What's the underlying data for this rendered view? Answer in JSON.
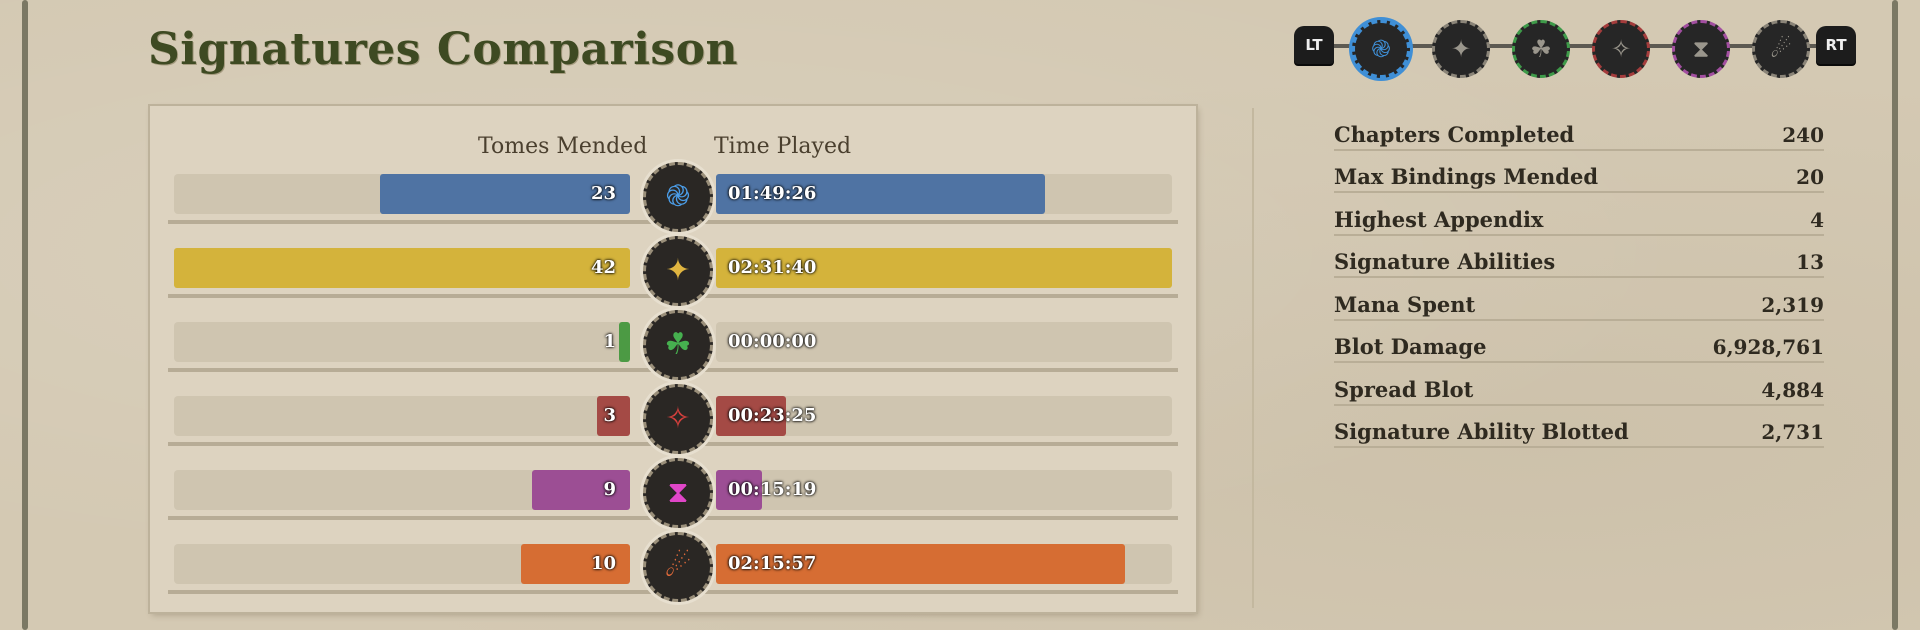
{
  "title": "Signatures Comparison",
  "selector": {
    "left_trigger": "LT",
    "right_trigger": "RT",
    "signatures": [
      {
        "name": "water-swirl-icon",
        "color": "#3f8fd6",
        "glyph": "֎",
        "selected": true
      },
      {
        "name": "star-compass-icon",
        "color": "#8a8478",
        "glyph": "✦",
        "selected": false
      },
      {
        "name": "triquetra-icon",
        "color": "#3e9a49",
        "glyph": "☘",
        "selected": false
      },
      {
        "name": "crimson-star-icon",
        "color": "#a43c3c",
        "glyph": "✧",
        "selected": false
      },
      {
        "name": "hourglass-icon",
        "color": "#a24ea0",
        "glyph": "⧗",
        "selected": false
      },
      {
        "name": "flame-slash-icon",
        "color": "#8a8478",
        "glyph": "☄",
        "selected": false
      }
    ]
  },
  "comparison": {
    "left_header": "Tomes Mended",
    "right_header": "Time Played",
    "max_tomes": 42,
    "max_seconds": 9100,
    "rows": [
      {
        "icon": "water-swirl-icon",
        "glyph": "֎",
        "glyph_color": "#4b9ce6",
        "bar_color": "#4f73a3",
        "tomes": "23",
        "tomes_value": 23,
        "time": "01:49:26",
        "time_seconds": 6566
      },
      {
        "icon": "golden-star-icon",
        "glyph": "✦",
        "glyph_color": "#e0b540",
        "bar_color": "#d4b33b",
        "tomes": "42",
        "tomes_value": 42,
        "time": "02:31:40",
        "time_seconds": 9100
      },
      {
        "icon": "triquetra-icon",
        "glyph": "☘",
        "glyph_color": "#46b04f",
        "bar_color": "#4c9a44",
        "tomes": "1",
        "tomes_value": 1,
        "time": "00:00:00",
        "time_seconds": 0
      },
      {
        "icon": "crimson-star-icon",
        "glyph": "✧",
        "glyph_color": "#d6403d",
        "bar_color": "#a44a45",
        "tomes": "3",
        "tomes_value": 3,
        "time": "00:23:25",
        "time_seconds": 1405
      },
      {
        "icon": "hourglass-icon",
        "glyph": "⧗",
        "glyph_color": "#e046c8",
        "bar_color": "#9c4e94",
        "tomes": "9",
        "tomes_value": 9,
        "time": "00:15:19",
        "time_seconds": 919
      },
      {
        "icon": "flame-slash-icon",
        "glyph": "☄",
        "glyph_color": "#e06a3a",
        "bar_color": "#d66d33",
        "tomes": "10",
        "tomes_value": 10,
        "time": "02:15:57",
        "time_seconds": 8157
      }
    ]
  },
  "stats": [
    {
      "label": "Chapters Completed",
      "value": "240"
    },
    {
      "label": "Max Bindings Mended",
      "value": "20"
    },
    {
      "label": "Highest Appendix",
      "value": "4"
    },
    {
      "label": "Signature Abilities",
      "value": "13"
    },
    {
      "label": "Mana Spent",
      "value": "2,319"
    },
    {
      "label": "Blot Damage",
      "value": "6,928,761"
    },
    {
      "label": "Spread Blot",
      "value": "4,884"
    },
    {
      "label": "Signature Ability Blotted",
      "value": "2,731"
    }
  ]
}
